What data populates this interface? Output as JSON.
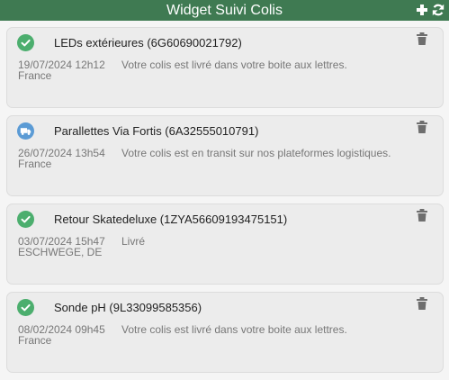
{
  "header": {
    "title": "Widget Suivi Colis",
    "add_icon": "plus-icon",
    "refresh_icon": "refresh-icon"
  },
  "colors": {
    "header_bg": "#3f7a52",
    "delivered": "#4cae6e",
    "in_transit": "#5b9bd5"
  },
  "parcels": [
    {
      "status_icon": "check-icon",
      "title": "LEDs extérieures (6G60690021792)",
      "datetime": "19/07/2024 12h12",
      "message": "Votre colis est livré dans votre boite aux lettres.",
      "location": "France"
    },
    {
      "status_icon": "truck-icon",
      "title": "Parallettes Via Fortis (6A32555010791)",
      "datetime": "26/07/2024 13h54",
      "message": "Votre colis est en transit sur nos plateformes logistiques.",
      "location": "France"
    },
    {
      "status_icon": "check-icon",
      "title": "Retour Skatedeluxe (1ZYA56609193475151)",
      "datetime": "03/07/2024 15h47",
      "message": "Livré",
      "location": "ESCHWEGE, DE"
    },
    {
      "status_icon": "check-icon",
      "title": "Sonde pH (9L33099585356)",
      "datetime": "08/02/2024 09h45",
      "message": "Votre colis est livré dans votre boite aux lettres.",
      "location": "France"
    }
  ]
}
